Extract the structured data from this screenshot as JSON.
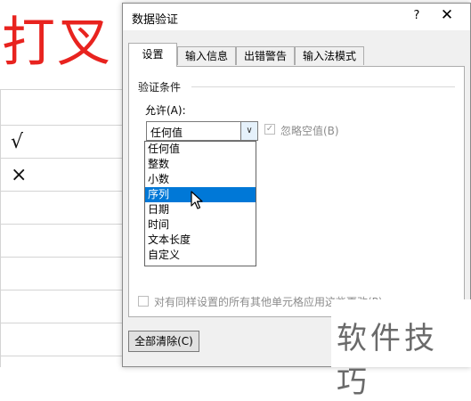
{
  "sheet": {
    "big_text": "打叉",
    "cell_check": "√",
    "cell_cross": "×"
  },
  "watermark": {
    "text": "软件技巧"
  },
  "dialog": {
    "title": "数据验证",
    "help": "?",
    "close": "✕",
    "tabs": [
      "设置",
      "输入信息",
      "出错警告",
      "输入法模式"
    ],
    "group_label": "验证条件",
    "allow_label": "允许(A):",
    "allow_value": "任何值",
    "combo_arrow": "∨",
    "ignore_blank": "忽略空值(B)",
    "ignore_check_mark": "✓",
    "dropdown_items": [
      "任何值",
      "整数",
      "小数",
      "序列",
      "日期",
      "时间",
      "文本长度",
      "自定义"
    ],
    "selected_index": 3,
    "apply_all": "对有同样设置的所有其他单元格应用这些更改(P)",
    "clear_all": "全部清除(C)"
  }
}
